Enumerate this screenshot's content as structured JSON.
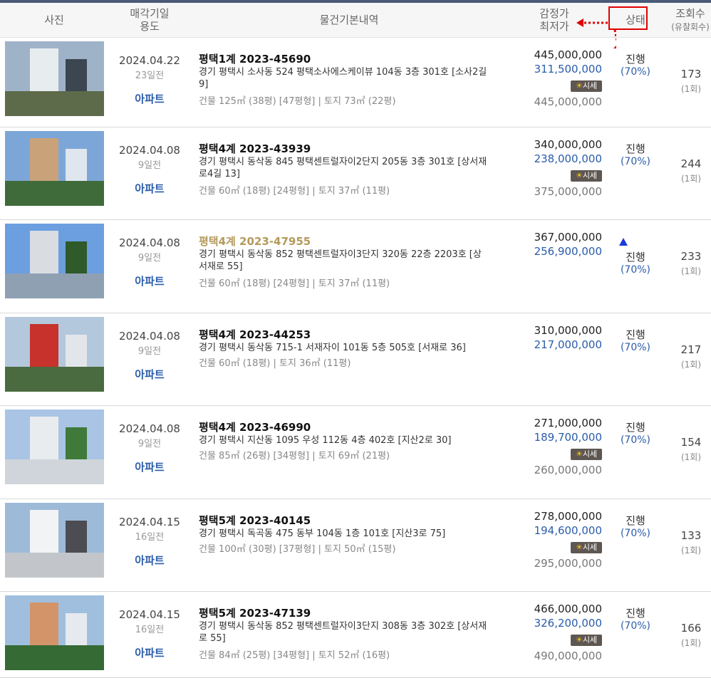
{
  "header": {
    "photo": "사진",
    "date_line1": "매각기일",
    "date_line2": "용도",
    "basic": "물건기본내역",
    "price_line1": "감정가",
    "price_line2": "최저가",
    "status": "상태",
    "views_line1": "조회수",
    "views_line2": "(유찰회수)"
  },
  "sise_label": "시세",
  "sise_icon": "sun-icon",
  "colors": {
    "accent_blue": "#2a5caa",
    "highlight_red": "#e00000",
    "top_bar": "#4a5a78"
  },
  "rows": [
    {
      "date": "2024.04.22",
      "ago": "23일전",
      "usage": "아파트",
      "title": "평택1계 2023-45690",
      "addr1": "경기 평택시 소사동 524 평택소사에스케이뷰 104동 3층 301호 [소사2길",
      "addr2": "9]",
      "area": "건물 125㎡ (38평) [47평형]  |  토지 73㎡ (22평)",
      "price": "445,000,000",
      "min": "311,500,000",
      "market": "445,000,000",
      "status": "진행",
      "pct": "(70%)",
      "views": "173",
      "fails": "(1회)"
    },
    {
      "date": "2024.04.08",
      "ago": "9일전",
      "usage": "아파트",
      "title": "평택4계 2023-43939",
      "addr1": "경기 평택시 동삭동 845 평택센트럴자이2단지 205동 3층 301호 [상서재",
      "addr2": "로4길 13]",
      "area": "건물 60㎡ (18평) [24평형]  |  토지 37㎡ (11평)",
      "price": "340,000,000",
      "min": "238,000,000",
      "market": "375,000,000",
      "status": "진행",
      "pct": "(70%)",
      "views": "244",
      "fails": "(1회)"
    },
    {
      "date": "2024.04.08",
      "ago": "9일전",
      "usage": "아파트",
      "title": "평택4계 2023-47955",
      "addr1": "경기 평택시 동삭동 852 평택센트럴자이3단지 320동 22층 2203호 [상",
      "addr2": "서재로 55]",
      "area": "건물 60㎡ (18평) [24평형]  |  토지 37㎡ (11평)",
      "price": "367,000,000",
      "min": "256,900,000",
      "market": "",
      "status": "진행",
      "pct": "(70%)",
      "views": "233",
      "fails": "(1회)"
    },
    {
      "date": "2024.04.08",
      "ago": "9일전",
      "usage": "아파트",
      "title": "평택4계 2023-44253",
      "addr1": "경기 평택시 동삭동 715-1 서재자이 101동 5층 505호 [서재로 36]",
      "addr2": "",
      "area": "건물 60㎡ (18평)  |  토지 36㎡ (11평)",
      "price": "310,000,000",
      "min": "217,000,000",
      "market": "",
      "status": "진행",
      "pct": "(70%)",
      "views": "217",
      "fails": "(1회)"
    },
    {
      "date": "2024.04.08",
      "ago": "9일전",
      "usage": "아파트",
      "title": "평택4계 2023-46990",
      "addr1": "경기 평택시 지산동 1095 우성 112동 4층 402호 [지산2로 30]",
      "addr2": "",
      "area": "건물 85㎡ (26평) [34평형]  |  토지 69㎡ (21평)",
      "price": "271,000,000",
      "min": "189,700,000",
      "market": "260,000,000",
      "status": "진행",
      "pct": "(70%)",
      "views": "154",
      "fails": "(1회)"
    },
    {
      "date": "2024.04.15",
      "ago": "16일전",
      "usage": "아파트",
      "title": "평택5계 2023-40145",
      "addr1": "경기 평택시 독곡동 475 동부 104동 1층 101호 [지산3로 75]",
      "addr2": "",
      "area": "건물 100㎡ (30평) [37평형]  |  토지 50㎡ (15평)",
      "price": "278,000,000",
      "min": "194,600,000",
      "market": "295,000,000",
      "status": "진행",
      "pct": "(70%)",
      "views": "133",
      "fails": "(1회)"
    },
    {
      "date": "2024.04.15",
      "ago": "16일전",
      "usage": "아파트",
      "title": "평택5계 2023-47139",
      "addr1": "경기 평택시 동삭동 852 평택센트럴자이3단지 308동 3층 302호 [상서재",
      "addr2": "로 55]",
      "area": "건물 84㎡ (25평) [34평형]  |  토지 52㎡ (16평)",
      "price": "466,000,000",
      "min": "326,200,000",
      "market": "490,000,000",
      "status": "진행",
      "pct": "(70%)",
      "views": "166",
      "fails": "(1회)"
    }
  ]
}
